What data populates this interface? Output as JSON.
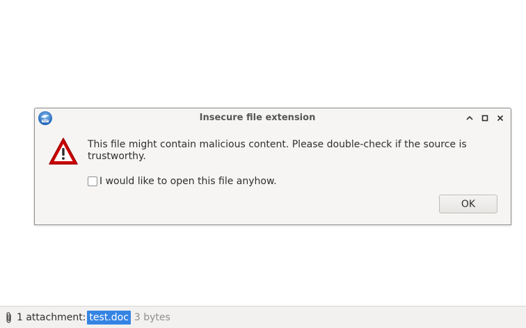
{
  "dialog": {
    "title": "Insecure file extension",
    "message": "This file might contain malicious content. Please double-check if the source is trustworthy.",
    "checkbox_label": "I would like to open this file anyhow.",
    "checkbox_checked": false,
    "ok_label": "OK",
    "icons": {
      "app": "thunderbird-icon",
      "warning": "warning-icon",
      "minimize": "chevron-up-icon",
      "maximize": "maximize-icon",
      "close": "close-icon"
    }
  },
  "attachment_bar": {
    "count_label": "1 attachment:",
    "file_name": "test.doc",
    "file_size": "3 bytes",
    "icon": "paperclip-icon"
  },
  "colors": {
    "dialog_bg": "#f6f5f4",
    "selection": "#3584e4",
    "warning_red": "#cc0000",
    "title_text": "#555753"
  }
}
